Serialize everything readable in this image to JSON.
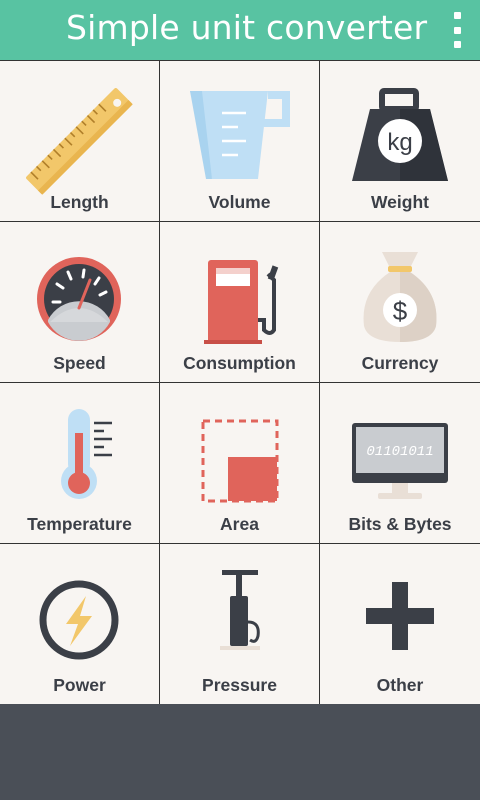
{
  "appbar": {
    "title": "Simple unit converter",
    "menu_icon": "overflow-menu-icon"
  },
  "categories": [
    {
      "label": "Length",
      "icon": "ruler-icon"
    },
    {
      "label": "Volume",
      "icon": "measuring-jug-icon"
    },
    {
      "label": "Weight",
      "icon": "kg-weight-icon"
    },
    {
      "label": "Speed",
      "icon": "speedometer-icon"
    },
    {
      "label": "Consumption",
      "icon": "fuel-pump-icon"
    },
    {
      "label": "Currency",
      "icon": "money-bag-icon"
    },
    {
      "label": "Temperature",
      "icon": "thermometer-icon"
    },
    {
      "label": "Area",
      "icon": "area-square-icon"
    },
    {
      "label": "Bits & Bytes",
      "icon": "computer-monitor-icon"
    },
    {
      "label": "Power",
      "icon": "lightning-bolt-icon"
    },
    {
      "label": "Pressure",
      "icon": "air-pump-icon"
    },
    {
      "label": "Other",
      "icon": "plus-icon"
    }
  ],
  "icon_text": {
    "weight_unit": "kg",
    "currency_symbol": "$",
    "binary": "01101011"
  },
  "colors": {
    "appbar": "#58c3a2",
    "tile_bg": "#f8f5f2",
    "label": "#3b3f47",
    "footer": "#4a4f57",
    "accent_red": "#e0645b",
    "accent_yellow": "#f2c76a"
  }
}
